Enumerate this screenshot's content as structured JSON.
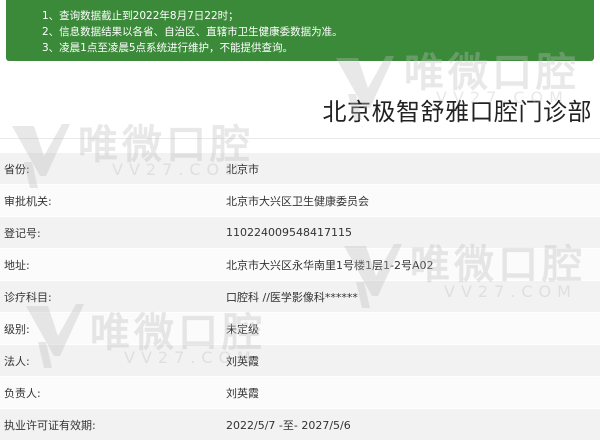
{
  "notice": {
    "lines": [
      "1、查询数据截止到2022年8月7日22时；",
      "2、信息数据结果以各省、自治区、直辖市卫生健康委数据为准。",
      "3、凌晨1点至凌晨5点系统进行维护，不能提供查询。"
    ]
  },
  "clinic": {
    "name": "北京极智舒雅口腔门诊部"
  },
  "table": {
    "rows": [
      {
        "label": "省份:",
        "value": "北京市"
      },
      {
        "label": "审批机关:",
        "value": "北京市大兴区卫生健康委员会"
      },
      {
        "label": "登记号:",
        "value": "110224009548417115"
      },
      {
        "label": "地址:",
        "value": "北京市大兴区永华南里1号楼1层1-2号A02"
      },
      {
        "label": "诊疗科目:",
        "value": "口腔科 //医学影像科******"
      },
      {
        "label": "级别:",
        "value": "未定级"
      },
      {
        "label": "法人:",
        "value": "刘英霞"
      },
      {
        "label": "负责人:",
        "value": "刘英霞"
      },
      {
        "label": "执业许可证有效期:",
        "value": "2022/5/7 -至- 2027/5/6"
      }
    ]
  },
  "watermark": {
    "text": "唯微口腔",
    "sub": "VV27.COM"
  },
  "colors": {
    "notice_bg": "#3a8a39",
    "row_odd": "#f2f2f2",
    "row_even": "#fbfbfb"
  }
}
